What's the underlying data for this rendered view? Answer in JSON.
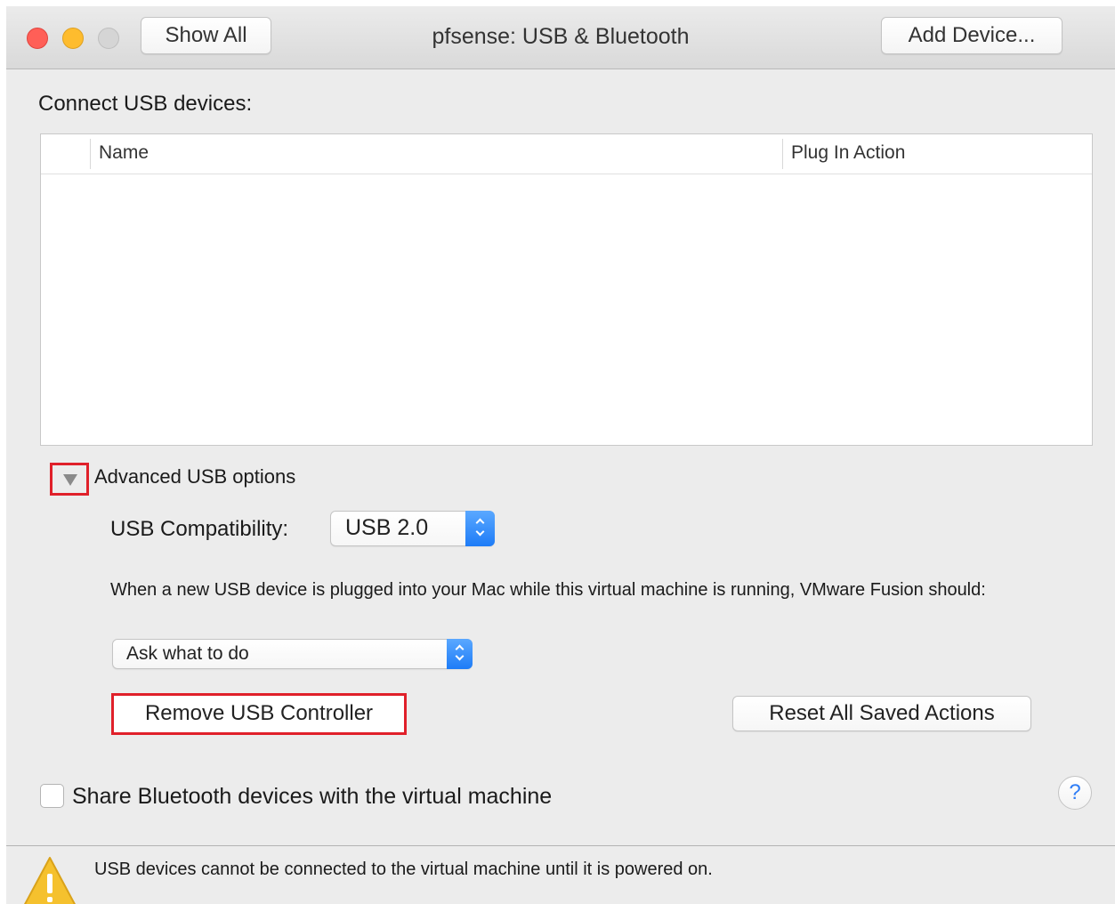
{
  "window": {
    "title": "pfsense: USB & Bluetooth"
  },
  "toolbar": {
    "show_all_label": "Show All",
    "add_device_label": "Add Device..."
  },
  "usb": {
    "section_title": "Connect USB devices:",
    "table": {
      "columns": [
        "Name",
        "Plug In Action"
      ],
      "rows": []
    },
    "advanced_label": "Advanced USB options",
    "compatibility_label": "USB Compatibility:",
    "compatibility_value": "USB 2.0",
    "plug_in_text": "When a new USB device is plugged into your Mac while this virtual machine is running, VMware Fusion should:",
    "plug_in_action_value": "Ask what to do",
    "remove_controller_label": "Remove USB Controller",
    "reset_actions_label": "Reset All Saved Actions"
  },
  "bluetooth": {
    "share_label": "Share Bluetooth devices with the virtual machine",
    "checked": false
  },
  "help": {
    "label": "?"
  },
  "footer": {
    "warning_text": "USB devices cannot be connected to the virtual machine until it is powered on."
  },
  "colors": {
    "highlight": "#e0202a",
    "stepper_blue": "#1e7cf7",
    "warning_yellow": "#f5c12e"
  }
}
